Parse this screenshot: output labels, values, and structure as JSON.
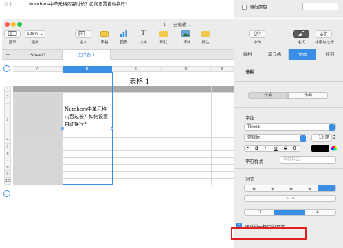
{
  "top_strip": {
    "cell_label": "文本",
    "cell_text": "Numbers中单元格内容过长？如何设置自动换行?",
    "checkbox_label": "随行颜色"
  },
  "window": {
    "title": "1 — 已编辑",
    "title_suffix": "⌄"
  },
  "toolbar": {
    "view_label": "显示",
    "zoom_value": "125%",
    "zoom_label": "缩放",
    "insert_label": "插入",
    "table_label": "表格",
    "chart_label": "图表",
    "text_label": "文本",
    "shape_label": "形状",
    "media_label": "媒体",
    "comment_label": "批注",
    "collab_label": "协作",
    "format_label": "格式",
    "sort_label": "排序与过滤"
  },
  "tabs": {
    "add": "+",
    "sheet1": "Sheet1",
    "table1": "工作表 1"
  },
  "grid": {
    "columns": [
      "A",
      "B",
      "C",
      "D",
      "E"
    ],
    "rows": [
      "1",
      "2",
      "3",
      "4",
      "5",
      "6",
      "7",
      "8",
      "9",
      "10"
    ],
    "table_title": "表格 1",
    "cell_b3": "Numbers中单元格内容过长？如何设置自动换行?"
  },
  "inspector": {
    "tabs": [
      "表格",
      "单元格",
      "文本",
      "排列"
    ],
    "active_tab": "文本",
    "style_value": "多种",
    "style_seg": [
      "样式",
      "布局"
    ],
    "font_label": "字体",
    "font_name": "Times",
    "font_style": "常规体",
    "font_size": "12 磅",
    "bold": "B",
    "italic": "I",
    "underline": "U",
    "strike": "S",
    "gear": "⚙",
    "char_style_label": "字符样式",
    "char_style_value": "字符样式",
    "align_label": "对齐",
    "wrap_label": "硬排单元格中的文本",
    "accent_color": "#3a8ee6",
    "highlight_color": "#e02020"
  }
}
